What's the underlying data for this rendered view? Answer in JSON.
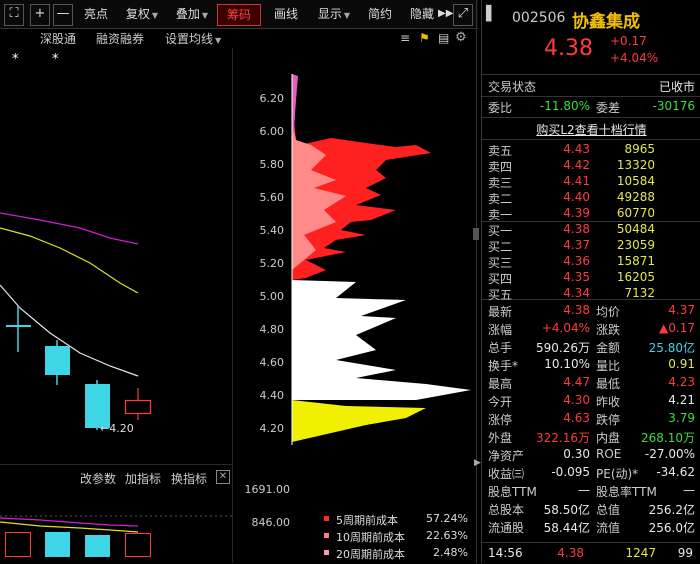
{
  "toolbar": {
    "plus": "+",
    "minus": "—",
    "highlight": "亮点",
    "restore_rights": "复权",
    "overlay": "叠加",
    "chips": "筹码",
    "draw_line": "画线",
    "display": "显示",
    "simple": "简约",
    "hide": "隐藏"
  },
  "subbar": {
    "shenzhen": "深股通",
    "margin": "融资融券",
    "ma_settings": "设置均线"
  },
  "chart": {
    "star1": "*",
    "star2": "*",
    "low_marker": "←4.20",
    "volume_axis": [
      "1691.00",
      "846.00"
    ]
  },
  "chip_axis": [
    "6.20",
    "6.00",
    "5.80",
    "5.60",
    "5.40",
    "5.20",
    "5.00",
    "4.80",
    "4.60",
    "4.40",
    "4.20"
  ],
  "indicator_bar": {
    "change_params": "改参数",
    "add_indicator": "加指标",
    "switch_indicator": "换指标"
  },
  "cost_legend": [
    {
      "label": "5周期前成本",
      "pct": "57.24%",
      "color": "#ff2a2a"
    },
    {
      "label": "10周期前成本",
      "pct": "22.63%",
      "color": "#ff7f7f"
    },
    {
      "label": "20周期前成本",
      "pct": "2.48%",
      "color": "#ff99aa"
    }
  ],
  "stock": {
    "code": "002506",
    "name": "协鑫集成",
    "price": "4.38",
    "change": "+0.17",
    "change_pct": "+4.04%",
    "status_label": "交易状态",
    "status_value": "已收市",
    "weibi_label": "委比",
    "weibi_value": "-11.80%",
    "weicha_label": "委差",
    "weicha_value": "-30176",
    "l2_link": "购买L2查看十档行情"
  },
  "sell_orders": [
    {
      "label": "卖五",
      "price": "4.43",
      "vol": "8965"
    },
    {
      "label": "卖四",
      "price": "4.42",
      "vol": "13320"
    },
    {
      "label": "卖三",
      "price": "4.41",
      "vol": "10584"
    },
    {
      "label": "卖二",
      "price": "4.40",
      "vol": "49288"
    },
    {
      "label": "卖一",
      "price": "4.39",
      "vol": "60770"
    }
  ],
  "buy_orders": [
    {
      "label": "买一",
      "price": "4.38",
      "vol": "50484"
    },
    {
      "label": "买二",
      "price": "4.37",
      "vol": "23059"
    },
    {
      "label": "买三",
      "price": "4.36",
      "vol": "15871"
    },
    {
      "label": "买四",
      "price": "4.35",
      "vol": "16205"
    },
    {
      "label": "买五",
      "price": "4.34",
      "vol": "7132"
    }
  ],
  "stats": [
    {
      "l1": "最新",
      "v1": "4.38",
      "c1": "red",
      "l2": "均价",
      "v2": "4.37",
      "c2": "red"
    },
    {
      "l1": "涨幅",
      "v1": "+4.04%",
      "c1": "red",
      "l2": "涨跌",
      "v2": "▲0.17",
      "c2": "red"
    },
    {
      "l1": "总手",
      "v1": "590.26万",
      "c1": "white",
      "l2": "金额",
      "v2": "25.80亿",
      "c2": "cyan"
    },
    {
      "l1": "换手*",
      "v1": "10.10%",
      "c1": "white",
      "l2": "量比",
      "v2": "0.91",
      "c2": "yellow"
    },
    {
      "l1": "最高",
      "v1": "4.47",
      "c1": "red",
      "l2": "最低",
      "v2": "4.23",
      "c2": "red"
    },
    {
      "l1": "今开",
      "v1": "4.30",
      "c1": "red",
      "l2": "昨收",
      "v2": "4.21",
      "c2": "white"
    },
    {
      "l1": "涨停",
      "v1": "4.63",
      "c1": "red",
      "l2": "跌停",
      "v2": "3.79",
      "c2": "green"
    },
    {
      "l1": "外盘",
      "v1": "322.16万",
      "c1": "red",
      "l2": "内盘",
      "v2": "268.10万",
      "c2": "green"
    },
    {
      "l1": "净资产",
      "v1": "0.30",
      "c1": "white",
      "l2": "ROE",
      "v2": "-27.00%",
      "c2": "white"
    },
    {
      "l1": "收益㈢",
      "v1": "-0.095",
      "c1": "white",
      "l2": "PE(动)*",
      "v2": "-34.62",
      "c2": "white"
    },
    {
      "l1": "股息TTM",
      "v1": "—",
      "c1": "white",
      "l2": "股息率TTM",
      "v2": "—",
      "c2": "white"
    },
    {
      "l1": "总股本",
      "v1": "58.50亿",
      "c1": "white",
      "l2": "总值",
      "v2": "256.2亿",
      "c2": "white"
    },
    {
      "l1": "流通股",
      "v1": "58.44亿",
      "c1": "white",
      "l2": "流值",
      "v2": "256.0亿",
      "c2": "white"
    }
  ],
  "tick": {
    "time": "14:56",
    "price": "4.38",
    "vol": "1247",
    "count": "99"
  },
  "colors": {
    "up": "#ff3b3b",
    "down": "#3ddc3d",
    "cyan": "#3ed6e6",
    "yellow": "#e6e64a"
  }
}
